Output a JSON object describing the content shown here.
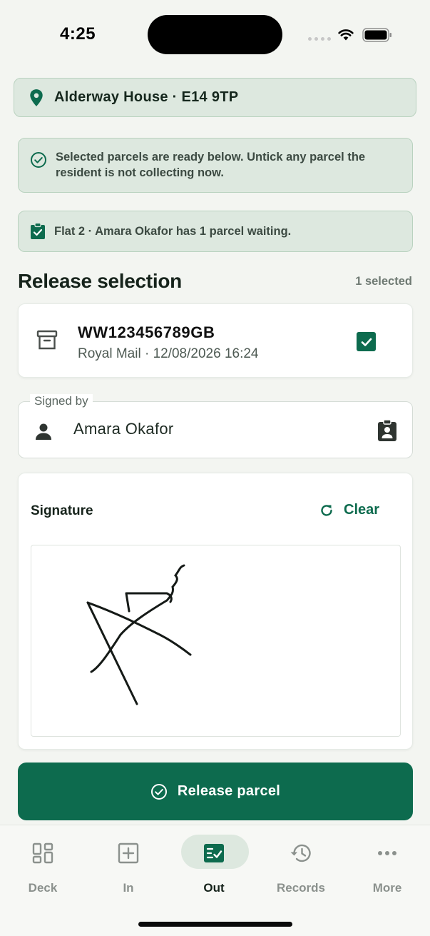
{
  "status_bar": {
    "time": "4:25"
  },
  "location": {
    "label": "Alderway House · E14 9TP"
  },
  "notices": [
    {
      "text": "Selected parcels are ready below. Untick any parcel the resident is not collecting now.",
      "icon": "check-circle-icon"
    },
    {
      "text": "Flat 2 · Amara Okafor has 1 parcel waiting.",
      "icon": "clipboard-check-icon"
    }
  ],
  "selection": {
    "title": "Release selection",
    "count_label": "1 selected",
    "parcels": [
      {
        "code": "WW123456789GB",
        "meta": "Royal Mail · 12/08/2026 16:24",
        "checked": true
      }
    ]
  },
  "signed_by": {
    "legend": "Signed by",
    "value": "Amara Okafor"
  },
  "signature": {
    "label": "Signature",
    "clear_label": "Clear"
  },
  "release_button": {
    "label": "Release parcel"
  },
  "tabs": [
    {
      "label": "Deck",
      "icon": "dashboard-icon",
      "active": false
    },
    {
      "label": "In",
      "icon": "plus-square-icon",
      "active": false
    },
    {
      "label": "Out",
      "icon": "checklist-icon",
      "active": true
    },
    {
      "label": "Records",
      "icon": "history-icon",
      "active": false
    },
    {
      "label": "More",
      "icon": "more-dots-icon",
      "active": false
    }
  ],
  "colors": {
    "brand": "#0d6b4e",
    "banner_bg": "#dde8df",
    "banner_border": "#b9d2bf",
    "page_bg": "#f3f5f1"
  }
}
